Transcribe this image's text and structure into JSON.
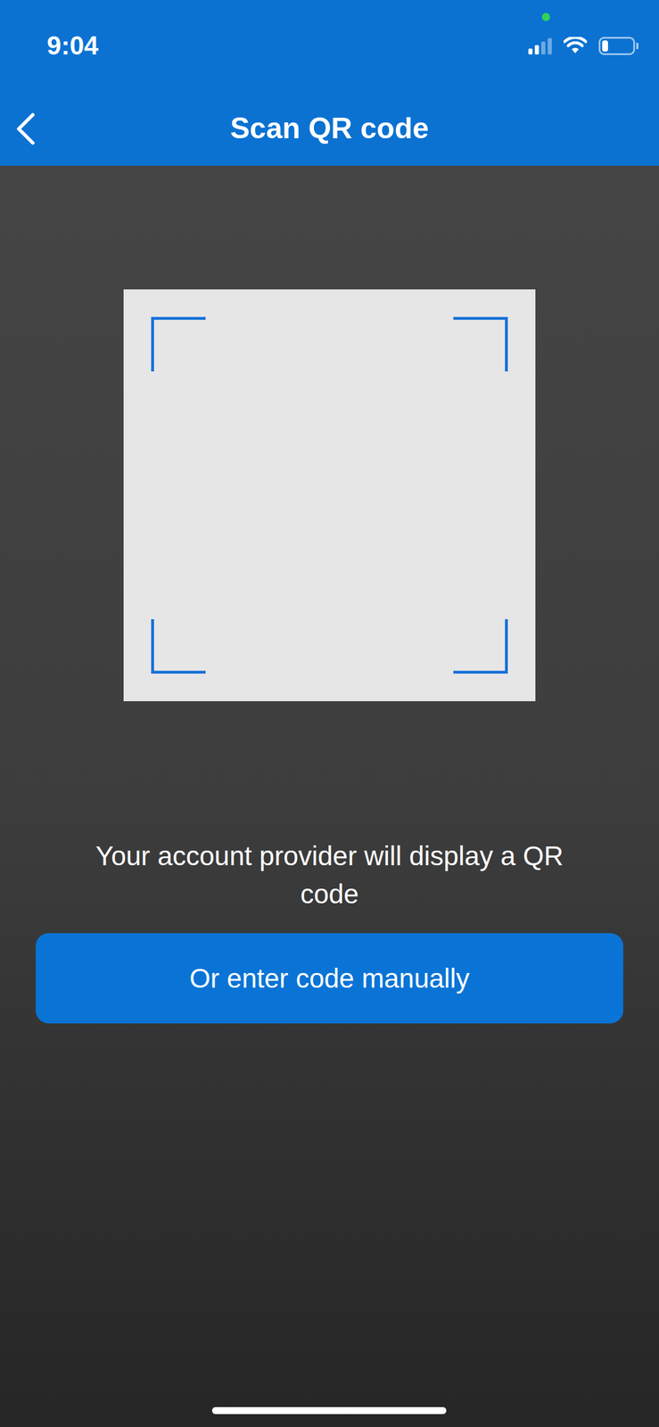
{
  "status_bar": {
    "time": "9:04",
    "signal_level": 0.5,
    "battery_level": 0.2
  },
  "nav": {
    "title": "Scan QR code"
  },
  "scanner": {
    "hint": "Your account provider will display a QR code"
  },
  "buttons": [
    "Or enter code manually"
  ]
}
